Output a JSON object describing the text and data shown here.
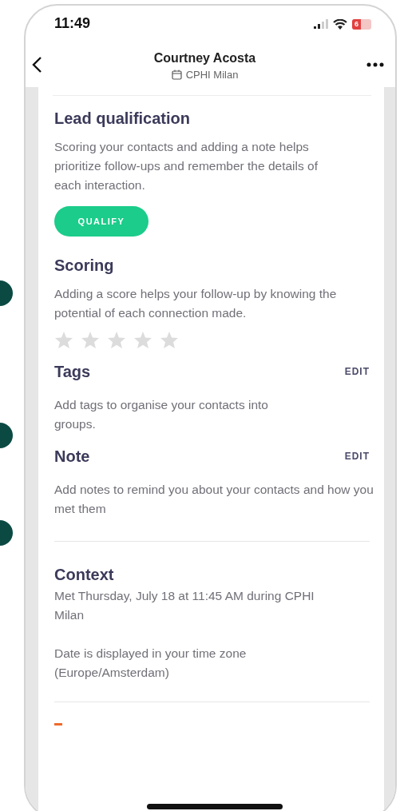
{
  "status_bar": {
    "time": "11:49",
    "battery": "6"
  },
  "header": {
    "title": "Courtney Acosta",
    "event": "CPHI Milan"
  },
  "sections": [
    {
      "kind": "action",
      "title": "Lead qualification",
      "text": "Scoring your contacts and adding a note helps prioritize follow-ups and remember the details of each interaction.",
      "button": "QUALIFY"
    },
    {
      "kind": "rating",
      "title": "Scoring",
      "text": "Adding a score helps your follow-up by knowing the potential of each connection made.",
      "stars": 0
    },
    {
      "kind": "editable",
      "title": "Tags",
      "action": "EDIT",
      "text": "Add tags to organise your contacts into groups."
    },
    {
      "kind": "editable",
      "title": "Note",
      "action": "EDIT",
      "text": "Add notes to remind you about your contacts and how you met them"
    },
    {
      "kind": "info",
      "title": "Context",
      "text": "Met Thursday, July 18 at 11:45 AM during CPHI Milan",
      "note": "Date is displayed in your time zone (Europe/Amsterdam)"
    }
  ]
}
